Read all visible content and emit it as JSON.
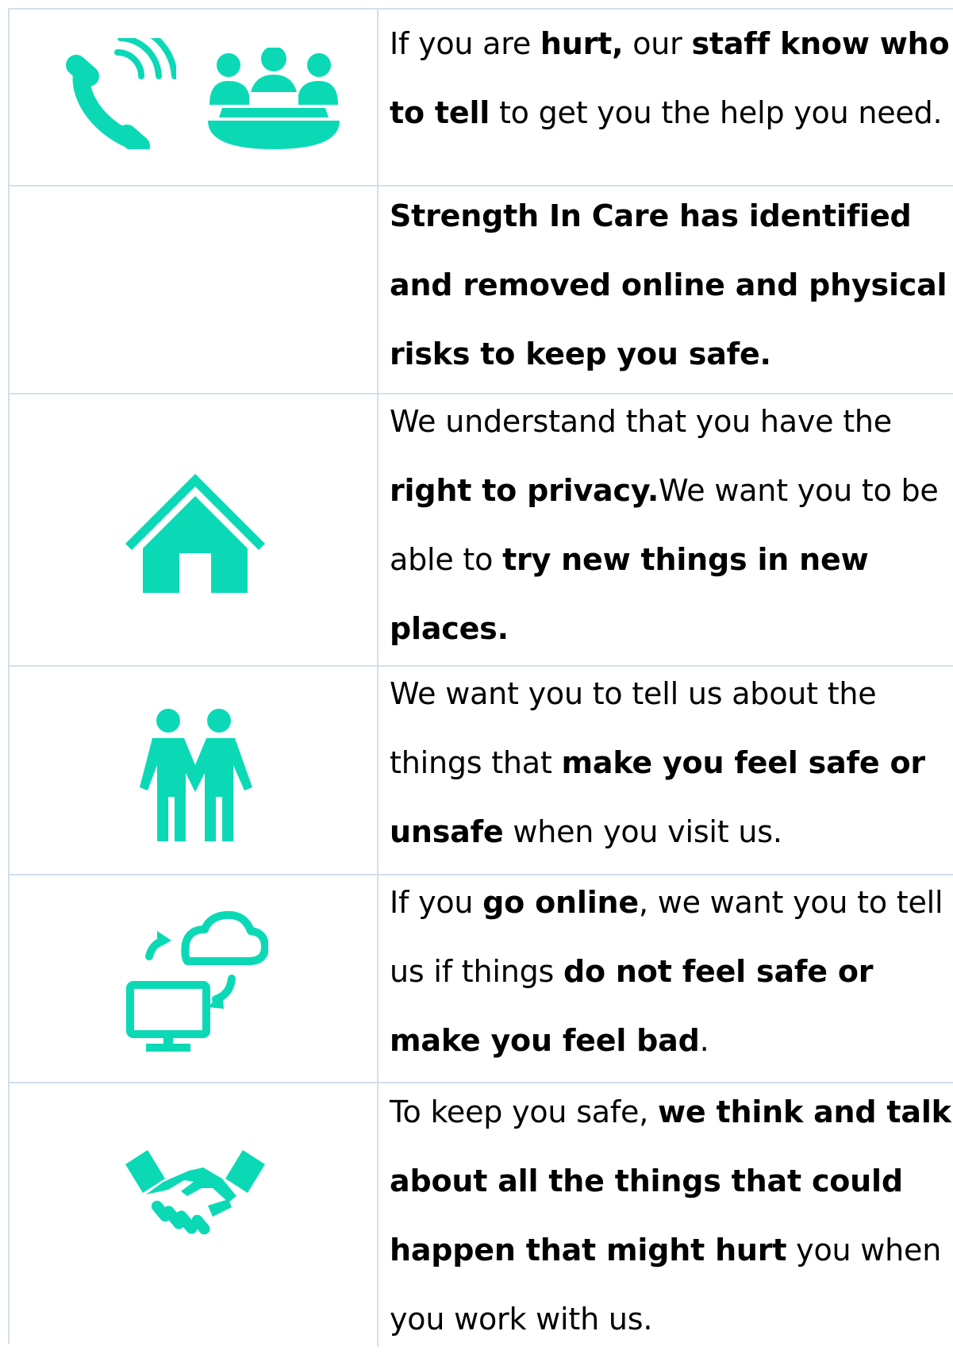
{
  "accent_color": "#0bd9b6",
  "rows": [
    {
      "icons": [
        "phone-ringing-icon",
        "meeting-group-icon"
      ],
      "segments": [
        {
          "text": "If you are ",
          "bold": false
        },
        {
          "text": "hurt,",
          "bold": true
        },
        {
          "text": " our ",
          "bold": false
        },
        {
          "text": "staff know who to tell",
          "bold": true
        },
        {
          "text": " to get you the help you need.",
          "bold": false
        }
      ]
    },
    {
      "icons": [],
      "segments": [
        {
          "text": "Strength In Care has identified and removed online and physical risks to keep you safe.",
          "bold": true
        }
      ]
    },
    {
      "icons": [
        "home-icon"
      ],
      "segments": [
        {
          "text": "We understand that you have the ",
          "bold": false
        },
        {
          "text": "right to privacy.",
          "bold": true
        },
        {
          "text": "We want you to be able to ",
          "bold": false
        },
        {
          "text": "try new things in new places.",
          "bold": true
        }
      ]
    },
    {
      "icons": [
        "two-people-icon"
      ],
      "segments": [
        {
          "text": "We want you to tell us about the things that ",
          "bold": false
        },
        {
          "text": "make you feel safe or unsafe",
          "bold": true
        },
        {
          "text": " when you visit us.",
          "bold": false
        }
      ]
    },
    {
      "icons": [
        "computer-cloud-sync-icon"
      ],
      "segments": [
        {
          "text": "If you ",
          "bold": false
        },
        {
          "text": "go online",
          "bold": true
        },
        {
          "text": ", we want you to tell us if things ",
          "bold": false
        },
        {
          "text": "do not feel safe or make you feel bad",
          "bold": true
        },
        {
          "text": ".",
          "bold": false
        }
      ]
    },
    {
      "icons": [
        "handshake-icon"
      ],
      "segments": [
        {
          "text": "To keep you safe, ",
          "bold": false
        },
        {
          "text": "we think and talk about all the things that could happen that might hurt",
          "bold": true
        },
        {
          "text": " you when you work with us.",
          "bold": false
        }
      ]
    }
  ]
}
